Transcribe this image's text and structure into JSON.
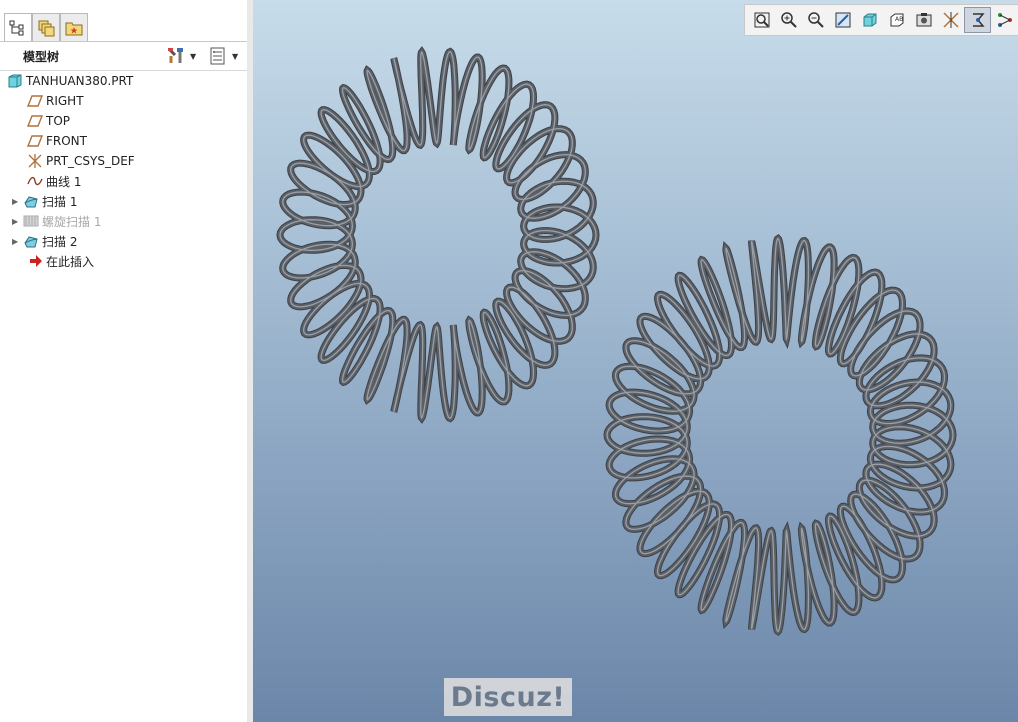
{
  "model_tree": {
    "title": "模型树",
    "items": [
      {
        "label": "TANHUAN380.PRT",
        "icon": "part-icon",
        "expander": false,
        "disabled": false
      },
      {
        "label": "RIGHT",
        "icon": "datum-plane-icon",
        "expander": false,
        "disabled": false
      },
      {
        "label": "TOP",
        "icon": "datum-plane-icon",
        "expander": false,
        "disabled": false
      },
      {
        "label": "FRONT",
        "icon": "datum-plane-icon",
        "expander": false,
        "disabled": false
      },
      {
        "label": "PRT_CSYS_DEF",
        "icon": "csys-icon",
        "expander": false,
        "disabled": false
      },
      {
        "label": "曲线 1",
        "icon": "curve-icon",
        "expander": false,
        "disabled": false
      },
      {
        "label": "扫描 1",
        "icon": "sweep-icon",
        "expander": true,
        "disabled": false
      },
      {
        "label": "螺旋扫描 1",
        "icon": "helical-sweep-icon",
        "expander": true,
        "disabled": true
      },
      {
        "label": "扫描 2",
        "icon": "sweep-icon",
        "expander": true,
        "disabled": false
      },
      {
        "label": "在此插入",
        "icon": "insert-arrow-icon",
        "expander": false,
        "disabled": false
      }
    ]
  },
  "view_toolbar": [
    "refit-icon",
    "zoom-in-icon",
    "zoom-out-icon",
    "repaint-icon",
    "display-style-icon",
    "saved-views-icon",
    "view-manager-icon",
    "perspective-icon",
    "datum-display-icon",
    "annotation-display-icon",
    "spin-center-icon"
  ],
  "view_toolbar_active": "annotation-display-icon",
  "watermark": "Discuz!",
  "colors": {
    "viewport_top": "#c7dcea",
    "viewport_bottom": "#6c86a9",
    "spring": "#5b5f66",
    "plane_icon": "#b0713a",
    "insert_arrow": "#cc2222"
  }
}
